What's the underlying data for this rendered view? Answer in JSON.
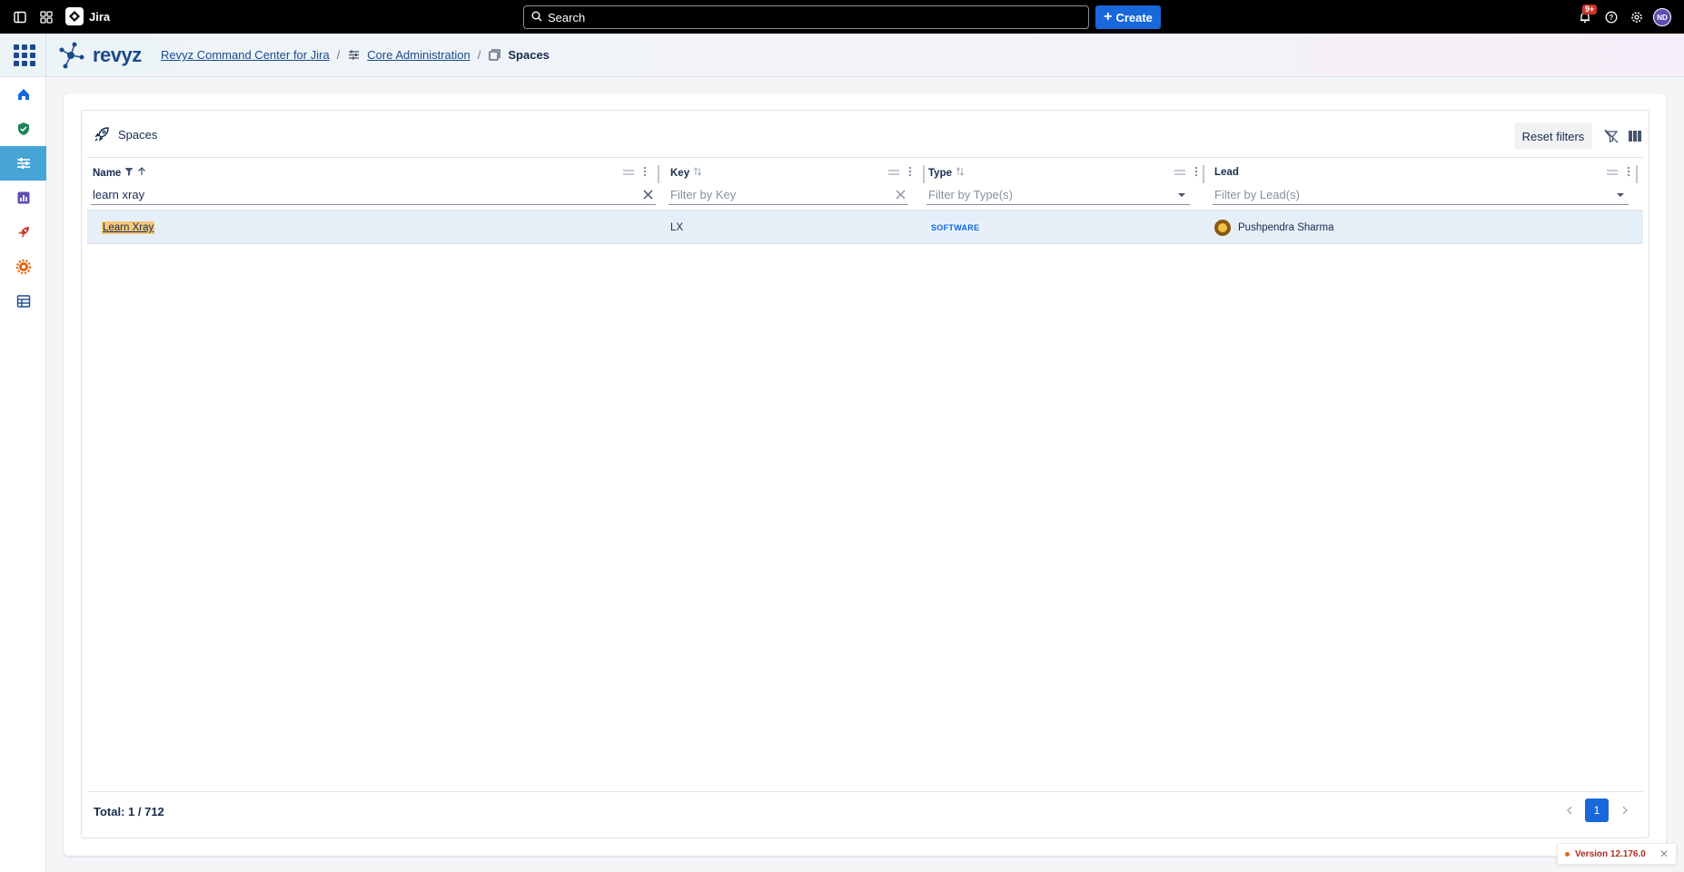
{
  "topbar": {
    "app_name": "Jira",
    "search_placeholder": "Search",
    "create_label": "Create",
    "notification_count": "9+",
    "user_initials": "ND"
  },
  "header": {
    "logo_text": "revyz",
    "breadcrumb": [
      {
        "label": "Revyz Command Center for Jira"
      },
      {
        "label": "Core Administration"
      },
      {
        "label": "Spaces"
      }
    ]
  },
  "sidebar": {
    "items": [
      {
        "icon": "home-icon"
      },
      {
        "icon": "shield-icon"
      },
      {
        "icon": "sliders-icon",
        "active": true
      },
      {
        "icon": "chart-icon"
      },
      {
        "icon": "rocket-icon"
      },
      {
        "icon": "gear-icon"
      },
      {
        "icon": "table-icon"
      }
    ]
  },
  "panel": {
    "title": "Spaces",
    "reset_label": "Reset filters"
  },
  "table": {
    "columns": [
      {
        "label": "Name",
        "filter_value": "learn xray",
        "filter_placeholder": ""
      },
      {
        "label": "Key",
        "filter_value": "",
        "filter_placeholder": "Filter by Key"
      },
      {
        "label": "Type",
        "filter_value": "",
        "filter_placeholder": "Filter by Type(s)"
      },
      {
        "label": "Lead",
        "filter_value": "",
        "filter_placeholder": "Filter by Lead(s)"
      }
    ],
    "rows": [
      {
        "name": "Learn Xray",
        "key": "LX",
        "type": "SOFTWARE",
        "lead": "Pushpendra Sharma"
      }
    ]
  },
  "footer": {
    "total": "Total: 1 / 712",
    "current_page": "1"
  },
  "version": "Version 12.176.0",
  "colors": {
    "accent": "#1868db",
    "sidebar_active": "#46a5d6",
    "brand": "#1c4a8d",
    "highlight": "#f5c77a"
  }
}
